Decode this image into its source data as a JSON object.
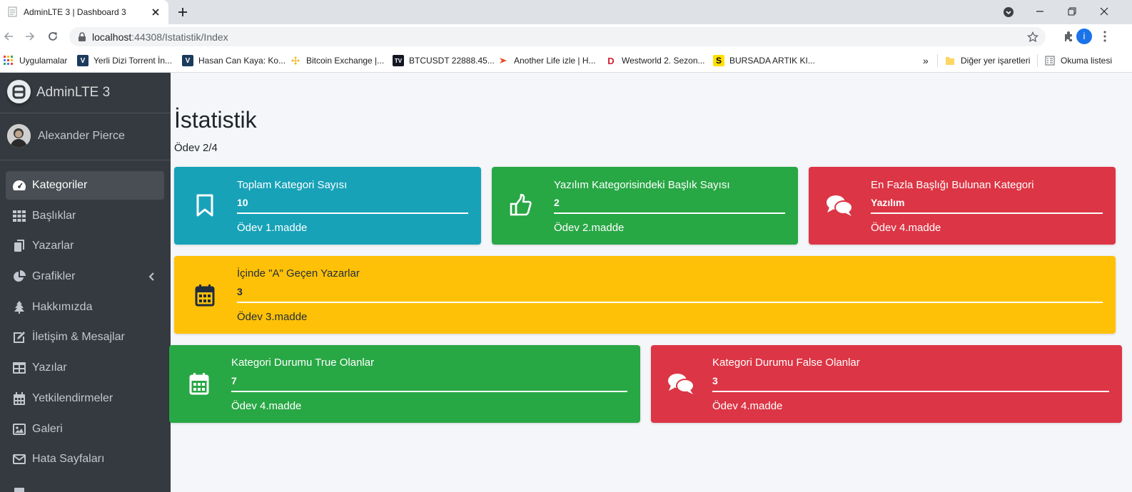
{
  "browser": {
    "tab_title": "AdminLTE 3 | Dashboard 3",
    "url_host": "localhost",
    "url_path": ":44308/Istatistik/Index",
    "profile_initial": "i",
    "bookmarks": [
      {
        "label": "Uygulamalar",
        "icon": "apps-grid-icon"
      },
      {
        "label": "Yerli Dizi Torrent İn...",
        "icon": "site-v-icon"
      },
      {
        "label": "Hasan Can Kaya: Ko...",
        "icon": "site-v-icon"
      },
      {
        "label": "Bitcoin Exchange |...",
        "icon": "binance-icon"
      },
      {
        "label": "BTCUSDT 22888.45...",
        "icon": "tradingview-icon"
      },
      {
        "label": "Another Life izle | H...",
        "icon": "play-site-icon"
      },
      {
        "label": "Westworld 2. Sezon...",
        "icon": "dizi-d-icon"
      },
      {
        "label": "BURSADA ARTIK KI...",
        "icon": "s-site-icon"
      }
    ],
    "more_bookmarks": "»",
    "other_bookmarks": "Diğer yer işaretleri",
    "reading_list": "Okuma listesi"
  },
  "sidebar": {
    "brand": "AdminLTE 3",
    "user": "Alexander Pierce",
    "items": [
      {
        "label": "Kategoriler",
        "icon": "tachometer-icon",
        "active": true
      },
      {
        "label": "Başlıklar",
        "icon": "th-grid-icon"
      },
      {
        "label": "Yazarlar",
        "icon": "copy-icon"
      },
      {
        "label": "Grafikler",
        "icon": "pie-chart-icon"
      },
      {
        "label": "Hakkımızda",
        "icon": "tree-icon"
      },
      {
        "label": "İletişim & Mesajlar",
        "icon": "edit-icon"
      },
      {
        "label": "Yazılar",
        "icon": "table-icon"
      },
      {
        "label": "Yetkilendirmeler",
        "icon": "calendar-icon"
      },
      {
        "label": "Galeri",
        "icon": "image-icon"
      },
      {
        "label": "Hata Sayfaları",
        "icon": "envelope-icon"
      }
    ]
  },
  "main": {
    "title": "İstatistik",
    "subtitle": "Ödev 2/4",
    "boxes": [
      {
        "title": "Toplam Kategori Sayısı",
        "value": "10",
        "desc": "Ödev 1.madde",
        "color": "#17a2b8",
        "icon": "bookmark-icon"
      },
      {
        "title": "Yazılım Kategorisindeki Başlık Sayısı",
        "value": "2",
        "desc": "Ödev 2.madde",
        "color": "#28a745",
        "icon": "thumbs-up-icon"
      },
      {
        "title": "En Fazla Başlığı Bulunan Kategori",
        "value": "Yazılım",
        "desc": "Ödev 4.madde",
        "color": "#dc3545",
        "icon": "comments-icon"
      },
      {
        "title": "İçinde \"A\" Geçen Yazarlar",
        "value": "3",
        "desc": "Ödev 3.madde",
        "color": "#ffc107",
        "icon": "calendar-icon"
      },
      {
        "title": "Kategori Durumu True Olanlar",
        "value": "7",
        "desc": "Ödev 4.madde",
        "color": "#28a745",
        "icon": "calendar-icon"
      },
      {
        "title": "Kategori Durumu False Olanlar",
        "value": "3",
        "desc": "Ödev 4.madde",
        "color": "#dc3545",
        "icon": "comments-icon"
      }
    ]
  }
}
